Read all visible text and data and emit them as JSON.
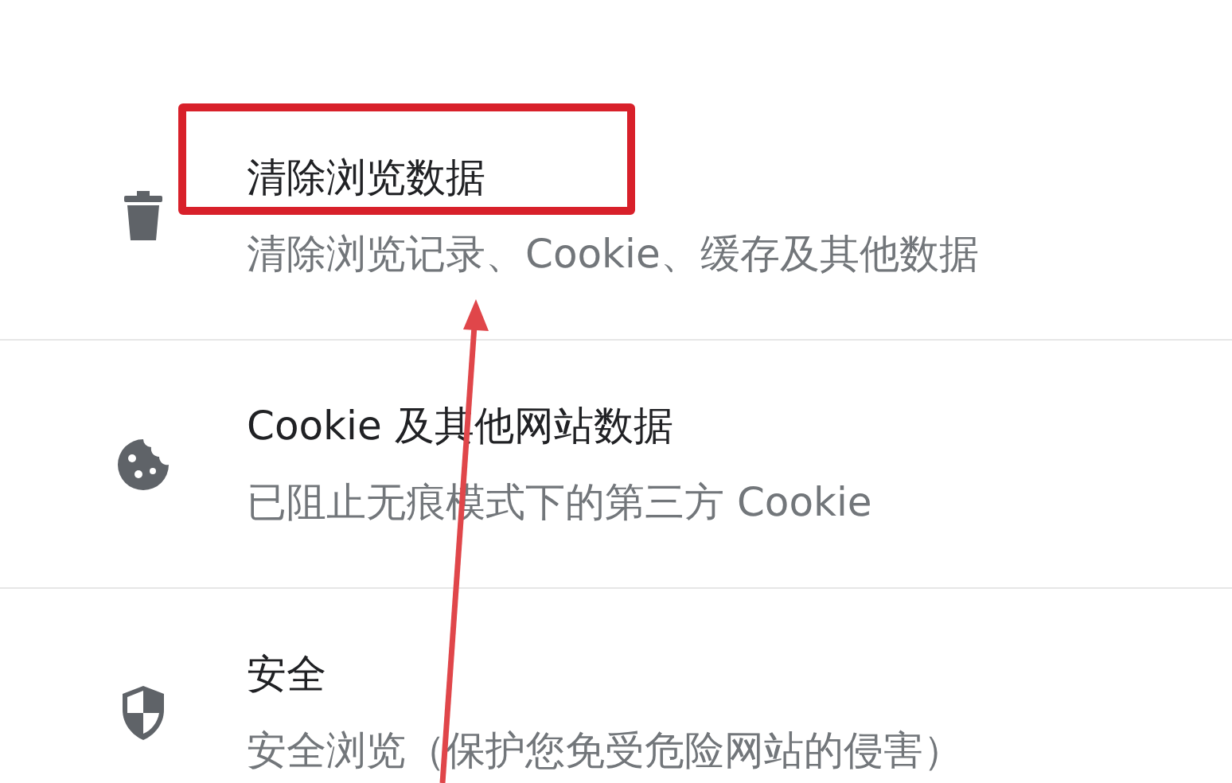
{
  "settings_rows": [
    {
      "kind": "trash",
      "title": "清除浏览数据",
      "subtitle": "清除浏览记录、Cookie、缓存及其他数据"
    },
    {
      "kind": "cookie",
      "title": "Cookie 及其他网站数据",
      "subtitle": "已阻止无痕模式下的第三方 Cookie"
    },
    {
      "kind": "shield",
      "title": "安全",
      "subtitle": "安全浏览（保护您免受危险网站的侵害）"
    }
  ],
  "annotations": [
    {
      "kind": "box",
      "color": "#d8202a"
    },
    {
      "kind": "arrow",
      "color": "#e0464a"
    }
  ]
}
